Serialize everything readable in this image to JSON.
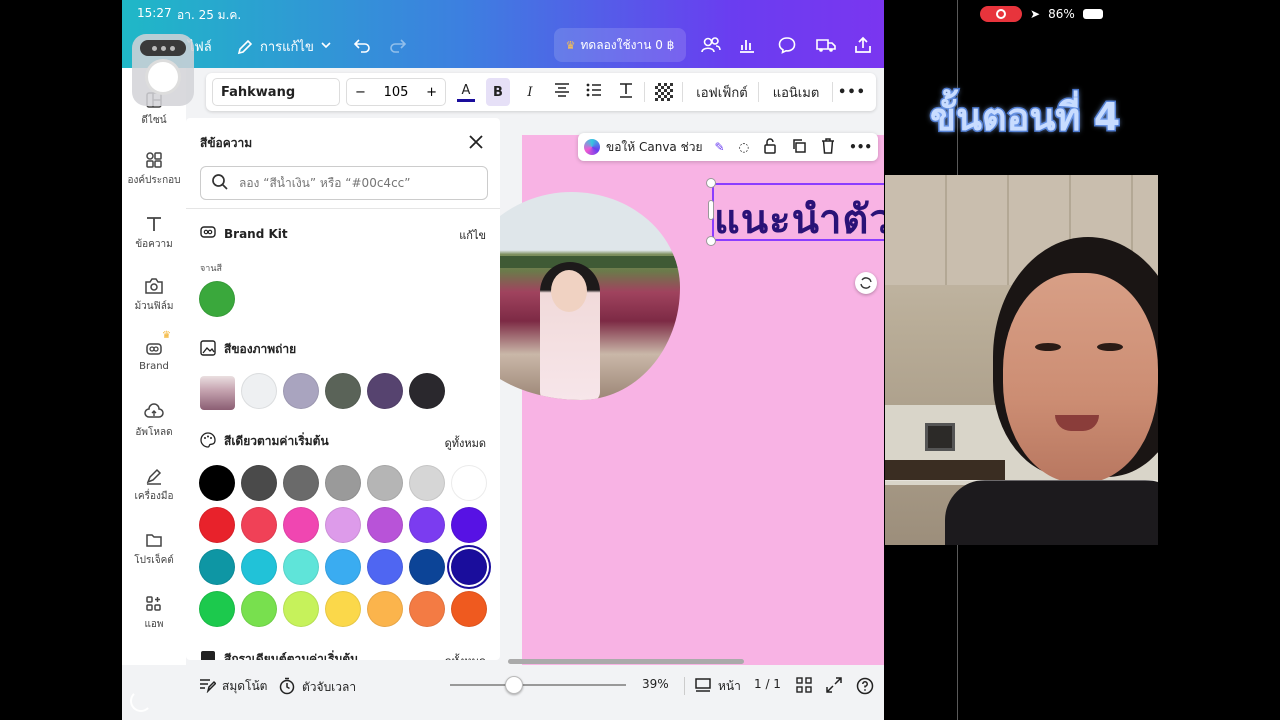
{
  "ios": {
    "time": "15:27",
    "date": "อา. 25 ม.ค.",
    "battery": "86%"
  },
  "topbar": {
    "file_label": "ไฟล์",
    "edit_label": "การแก้ไข",
    "trial_label": "ทดลองใช้งาน 0 ฿"
  },
  "leftnav": {
    "items": [
      {
        "label": "ดีไซน์",
        "icon": "layout-icon"
      },
      {
        "label": "องค์ประกอบ",
        "icon": "elements-icon"
      },
      {
        "label": "ข้อความ",
        "icon": "text-icon"
      },
      {
        "label": "ม้วนฟิล์ม",
        "icon": "camera-icon"
      },
      {
        "label": "Brand",
        "icon": "brand-icon"
      },
      {
        "label": "อัพโหลด",
        "icon": "upload-icon"
      },
      {
        "label": "เครื่องมือ",
        "icon": "tools-icon"
      },
      {
        "label": "โปรเจ็คต์",
        "icon": "folder-icon"
      },
      {
        "label": "แอพ",
        "icon": "apps-icon"
      }
    ]
  },
  "toolbar": {
    "font_name": "Fahkwang",
    "font_size": "105",
    "effects_label": "เอฟเฟ็กต์",
    "animate_label": "แอนิเมต"
  },
  "panel": {
    "title": "สีข้อความ",
    "search_placeholder": "ลอง “สีน้ำเงิน” หรือ “#00c4cc”",
    "brand_kit_label": "Brand Kit",
    "brand_kit_edit": "แก้ไข",
    "palette_label": "จานสี",
    "photo_colors_label": "สีของภาพถ่าย",
    "default_colors_label": "สีเดียวตามค่าเริ่มต้น",
    "default_colors_link": "ดูทั้งหมด",
    "gradient_label": "สีกราเดียนต์ตามค่าเริ่มต้น",
    "gradient_link": "ดูทั้งหมด",
    "brand_colors": [
      "#3aa83c"
    ],
    "photo_colors": [
      "#eef0f2",
      "#a9a4bf",
      "#5a6358",
      "#56436f",
      "#2a282d"
    ],
    "default_colors": [
      [
        "#000000",
        "#4a4a4a",
        "#6a6a6a",
        "#9a9a9a",
        "#b5b5b5",
        "#d6d6d6",
        "#ffffff"
      ],
      [
        "#e8222b",
        "#f04157",
        "#f046b1",
        "#dd9bea",
        "#b853d8",
        "#7b3cf0",
        "#5712e4"
      ],
      [
        "#0e96a4",
        "#21c2d8",
        "#5fe4d9",
        "#3aacf1",
        "#4f66f2",
        "#0c4497",
        "#1a0d9c"
      ],
      [
        "#1cc94d",
        "#78e04e",
        "#c6f25b",
        "#fbd84a",
        "#fbb44c",
        "#f37b44",
        "#ef5a1f"
      ]
    ],
    "selected_color": "#1a0d9c"
  },
  "canvas": {
    "text": "แนะนำตัว",
    "ctx_ask": "ขอให้ Canva ช่วย"
  },
  "bottombar": {
    "notes_label": "สมุดโน้ต",
    "timer_label": "ตัวจับเวลา",
    "zoom": "39%",
    "page_label": "หน้า",
    "page_count": "1 / 1"
  },
  "overlay": {
    "step_title": "ขั้นตอนที่ 4"
  }
}
